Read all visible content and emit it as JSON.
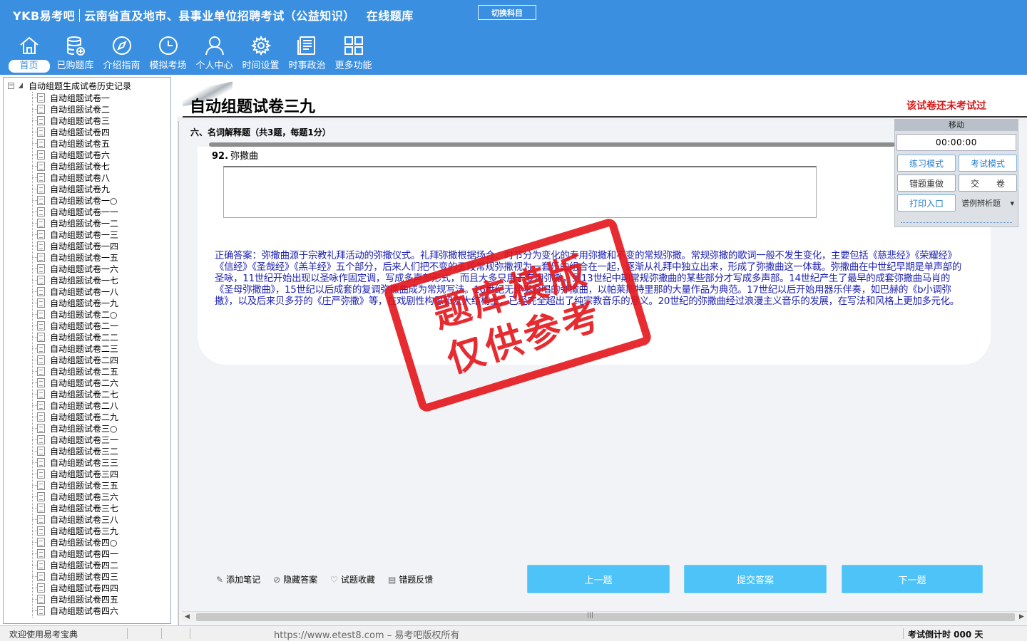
{
  "header": {
    "brand": "YKB易考吧",
    "exam_title": "云南省直及地市、县事业单位招聘考试（公益知识）",
    "bank_label": "在线题库",
    "switch_subject": "切换科目",
    "nav": [
      {
        "label": "首页",
        "icon": "home-icon"
      },
      {
        "label": "已购题库",
        "icon": "database-icon"
      },
      {
        "label": "介绍指南",
        "icon": "compass-icon"
      },
      {
        "label": "模拟考场",
        "icon": "clock-icon"
      },
      {
        "label": "个人中心",
        "icon": "user-icon"
      },
      {
        "label": "时间设置",
        "icon": "gear-icon"
      },
      {
        "label": "时事政治",
        "icon": "news-icon"
      },
      {
        "label": "更多功能",
        "icon": "grid-icon"
      }
    ]
  },
  "tree": {
    "root_label": "自动组题生成试卷历史记录",
    "items": [
      "自动组题试卷一",
      "自动组题试卷二",
      "自动组题试卷三",
      "自动组题试卷四",
      "自动组题试卷五",
      "自动组题试卷六",
      "自动组题试卷七",
      "自动组题试卷八",
      "自动组题试卷九",
      "自动组题试卷一○",
      "自动组题试卷一一",
      "自动组题试卷一二",
      "自动组题试卷一三",
      "自动组题试卷一四",
      "自动组题试卷一五",
      "自动组题试卷一六",
      "自动组题试卷一七",
      "自动组题试卷一八",
      "自动组题试卷一九",
      "自动组题试卷二○",
      "自动组题试卷二一",
      "自动组题试卷二二",
      "自动组题试卷二三",
      "自动组题试卷二四",
      "自动组题试卷二五",
      "自动组题试卷二六",
      "自动组题试卷二七",
      "自动组题试卷二八",
      "自动组题试卷二九",
      "自动组题试卷三○",
      "自动组题试卷三一",
      "自动组题试卷三二",
      "自动组题试卷三三",
      "自动组题试卷三四",
      "自动组题试卷三五",
      "自动组题试卷三六",
      "自动组题试卷三七",
      "自动组题试卷三八",
      "自动组题试卷三九",
      "自动组题试卷四○",
      "自动组题试卷四一",
      "自动组题试卷四二",
      "自动组题试卷四三",
      "自动组题试卷四四",
      "自动组题试卷四五",
      "自动组题试卷四六"
    ]
  },
  "paper": {
    "title": "自动组题试卷三九",
    "status": "该试卷还未考试过",
    "section": "六、名词解释题（共3题，每题1分）",
    "question_number": "92.",
    "question_text": "弥撒曲",
    "answer": "正确答案：弥撒曲源于宗教礼拜活动的弥撒仪式。礼拜弥撒根据场合、时节分为变化的专用弥撒和不变的常规弥撒。常规弥撒的歌词一般不发生变化，主要包括《慈悲经》《荣耀经》《信经》《圣哉经》《羔羊经》五个部分，后来人们把不变的五段常规弥撒视为一套乐曲组合在一起，逐渐从礼拜中独立出来，形成了弥撒曲这一体裁。弥撒曲在中世纪早期是单声部的圣咏，11世纪开始出现以圣咏作固定调，写成多声部形式，而且大多只用于专用弥撒，到13世纪中期常规弥撒曲的某些部分才写成多声部。14世纪产生了最早的成套弥撒曲马肖的《圣母弥撒曲》，15世纪以后成套的复调弥撒曲成为常规写法。16世纪无伴奏合唱的弥撒曲，以帕莱斯特里那的大量作品为典范。17世纪以后开始用器乐伴奏，如巴赫的《b小调弥撒》，以及后来贝多芬的《庄严弥撒》等，在戏剧性构思和宏大结构上，已经完全超出了纯宗教音乐的意义。20世纪的弥撒曲经过浪漫主义音乐的发展，在写法和风格上更加多元化。"
  },
  "actions": {
    "add_note": "添加笔记",
    "hide_answer": "隐藏答案",
    "favorite": "试题收藏",
    "feedback": "错题反馈",
    "prev": "上一题",
    "submit_answer": "提交答案",
    "next": "下一题"
  },
  "control": {
    "move": "移动",
    "timer": "00:00:00",
    "practice_mode": "练习模式",
    "exam_mode": "考试模式",
    "redo_wrong": "错题重做",
    "hand_in": "交　　卷",
    "print": "打印入口",
    "question_type": "谱例辨析题"
  },
  "stamp": {
    "line1": "题库模版",
    "line2": "仅供参考"
  },
  "statusbar": {
    "welcome": "欢迎使用易考宝典",
    "copyright": "https://www.etest8.com – 易考吧版权所有",
    "countdown": "考试倒计时 000 天"
  },
  "colors": {
    "header_bg": "#3b8fe0",
    "accent_button": "#4dc3f7",
    "status_red": "#d91b1b",
    "answer_blue": "#1b1fb0",
    "stamp_red": "#e4161b"
  }
}
